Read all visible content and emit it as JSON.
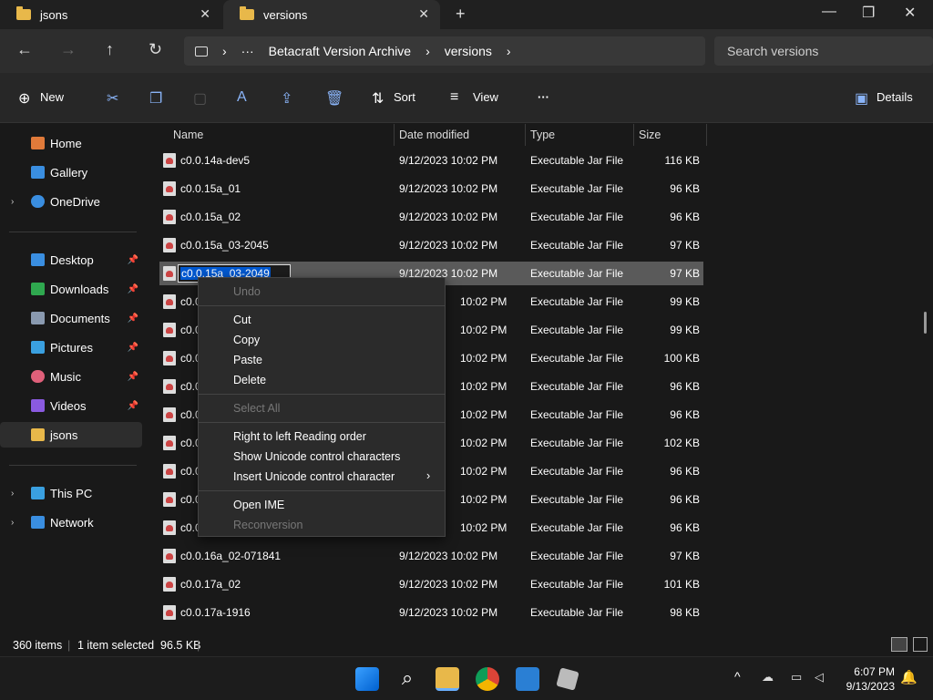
{
  "tabs": [
    {
      "title": "jsons",
      "close": "✕"
    },
    {
      "title": "versions",
      "close": "✕"
    }
  ],
  "new_tab": "+",
  "window": {
    "minimize": "—",
    "maximize": "❐",
    "close": "✕"
  },
  "nav": {
    "back": "←",
    "forward": "→",
    "up": "↑",
    "refresh": "↻"
  },
  "breadcrumb": {
    "more": "···",
    "items": [
      "Betacraft Version Archive",
      "versions"
    ],
    "separator": "›"
  },
  "search": {
    "placeholder": "Search versions"
  },
  "toolbar": {
    "new_label": "New",
    "sort_label": "Sort",
    "view_label": "View",
    "more": "···",
    "details_label": "Details"
  },
  "sidebar": {
    "top": [
      {
        "label": "Home"
      },
      {
        "label": "Gallery"
      },
      {
        "label": "OneDrive"
      }
    ],
    "quick": [
      {
        "label": "Desktop"
      },
      {
        "label": "Downloads"
      },
      {
        "label": "Documents"
      },
      {
        "label": "Pictures"
      },
      {
        "label": "Music"
      },
      {
        "label": "Videos"
      },
      {
        "label": "jsons"
      }
    ],
    "bottom": [
      {
        "label": "This PC"
      },
      {
        "label": "Network"
      }
    ]
  },
  "columns": {
    "name": "Name",
    "date": "Date modified",
    "type": "Type",
    "size": "Size"
  },
  "files": [
    {
      "name": "c0.0.14a-dev5",
      "date": "9/12/2023 10:02 PM",
      "type": "Executable Jar File",
      "size": "116 KB"
    },
    {
      "name": "c0.0.15a_01",
      "date": "9/12/2023 10:02 PM",
      "type": "Executable Jar File",
      "size": "96 KB"
    },
    {
      "name": "c0.0.15a_02",
      "date": "9/12/2023 10:02 PM",
      "type": "Executable Jar File",
      "size": "96 KB"
    },
    {
      "name": "c0.0.15a_03-2045",
      "date": "9/12/2023 10:02 PM",
      "type": "Executable Jar File",
      "size": "97 KB"
    },
    {
      "name": "c0.0.15a_03-2049",
      "date": "9/12/2023 10:02 PM",
      "type": "Executable Jar File",
      "size": "97 KB"
    },
    {
      "name": "c0.0",
      "date": "10:02 PM",
      "type": "Executable Jar File",
      "size": "99 KB"
    },
    {
      "name": "c0.0",
      "date": "10:02 PM",
      "type": "Executable Jar File",
      "size": "99 KB"
    },
    {
      "name": "c0.0",
      "date": "10:02 PM",
      "type": "Executable Jar File",
      "size": "100 KB"
    },
    {
      "name": "c0.0",
      "date": "10:02 PM",
      "type": "Executable Jar File",
      "size": "96 KB"
    },
    {
      "name": "c0.0",
      "date": "10:02 PM",
      "type": "Executable Jar File",
      "size": "96 KB"
    },
    {
      "name": "c0.0",
      "date": "10:02 PM",
      "type": "Executable Jar File",
      "size": "102 KB"
    },
    {
      "name": "c0.0",
      "date": "10:02 PM",
      "type": "Executable Jar File",
      "size": "96 KB"
    },
    {
      "name": "c0.0",
      "date": "10:02 PM",
      "type": "Executable Jar File",
      "size": "96 KB"
    },
    {
      "name": "c0.0",
      "date": "10:02 PM",
      "type": "Executable Jar File",
      "size": "96 KB"
    },
    {
      "name": "c0.0.16a_02-071841",
      "date": "9/12/2023 10:02 PM",
      "type": "Executable Jar File",
      "size": "97 KB"
    },
    {
      "name": "c0.0.17a_02",
      "date": "9/12/2023 10:02 PM",
      "type": "Executable Jar File",
      "size": "101 KB"
    },
    {
      "name": "c0.0.17a-1916",
      "date": "9/12/2023 10:02 PM",
      "type": "Executable Jar File",
      "size": "98 KB"
    }
  ],
  "rename_value": "c0.0.15a_03-2049",
  "context_menu": [
    "Undo",
    "Cut",
    "Copy",
    "Paste",
    "Delete",
    "Select All",
    "Right to left Reading order",
    "Show Unicode control characters",
    "Insert Unicode control character",
    "Open IME",
    "Reconversion"
  ],
  "status": {
    "count": "360 items",
    "selected": "1 item selected  96.5 KB"
  },
  "clock": {
    "time": "6:07 PM",
    "date": "9/13/2023"
  },
  "colors": {
    "accent": "#0058d0",
    "folder": "#e8b84a",
    "selection": "#5a5a5a"
  }
}
